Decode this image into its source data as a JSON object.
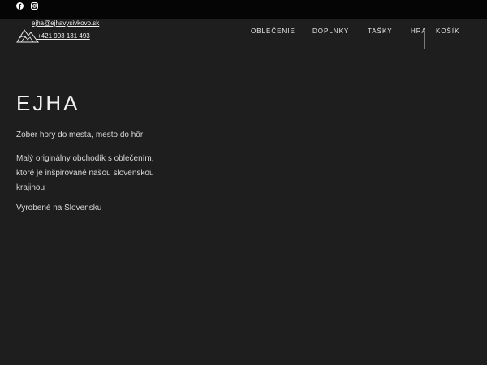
{
  "social": {
    "facebook_icon": "facebook-icon",
    "instagram_icon": "instagram-icon"
  },
  "contact": {
    "email": "ejha@ejhavysivkovo.sk",
    "phone": "+421 903 131 493"
  },
  "nav": {
    "items": [
      {
        "label": "OBLEČENIE"
      },
      {
        "label": "DOPLNKY"
      },
      {
        "label": "TAŠKY"
      },
      {
        "label": "HRA"
      },
      {
        "label": "KOŠÍK"
      }
    ]
  },
  "hero": {
    "title": "EJHA",
    "tagline": "Zober hory do mesta, mesto do hôr!",
    "description": "Malý originálny obchodík s oblečením, ktoré je inšpirované našou slovenskou krajinou",
    "made_in": "Vyrobené na Slovensku"
  },
  "colors": {
    "background": "#1e1e1e",
    "topbar": "#050505",
    "text": "#e6e6e6"
  }
}
